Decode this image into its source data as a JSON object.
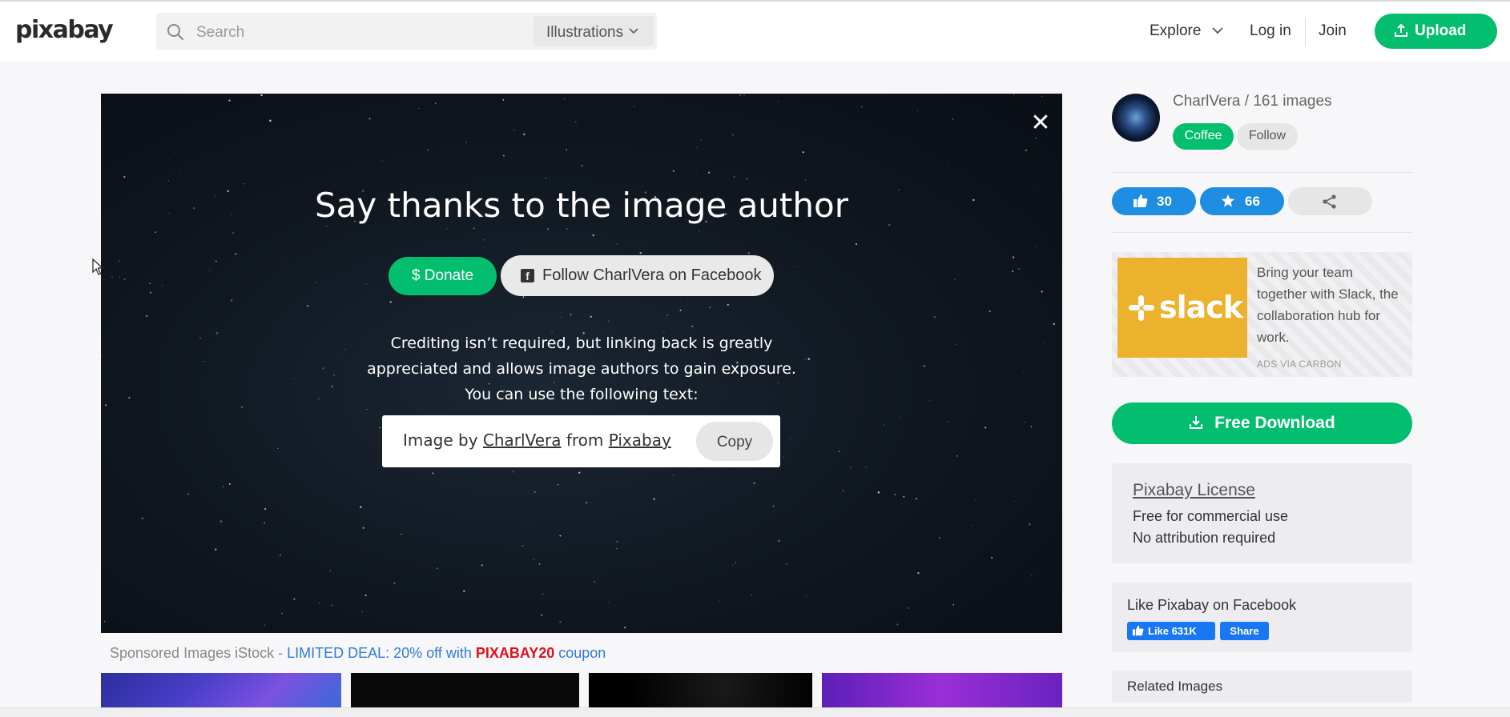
{
  "header": {
    "logo": "pixabay",
    "search_placeholder": "Search",
    "search_scope": "Illustrations",
    "nav_explore": "Explore",
    "nav_login": "Log in",
    "nav_join": "Join",
    "upload_label": "Upload"
  },
  "modal": {
    "title": "Say thanks to the image author",
    "donate_label": "$ Donate",
    "facebook_follow_label": "Follow CharlVera on Facebook",
    "credit_line1": "Crediting isn’t required, but linking back is greatly",
    "credit_line2": "appreciated and allows image authors to gain exposure.",
    "credit_line3": "You can use the following text:",
    "attribution": {
      "prefix": "Image by",
      "author": "CharlVera",
      "middle": "from",
      "site": "Pixabay"
    },
    "copy_label": "Copy",
    "close_glyph": "✕"
  },
  "sponsored": {
    "prefix": "Sponsored Images iStock - ",
    "deal": "LIMITED DEAL: 20% off with ",
    "code": "PIXABAY20",
    "suffix": " coupon"
  },
  "sidebar": {
    "author_line": "CharlVera / 161 images",
    "coffee_label": "Coffee",
    "follow_label": "Follow",
    "likes": "30",
    "favorites": "66",
    "ad": {
      "logo": "slack",
      "text": "Bring your team together with Slack, the collaboration hub for work.",
      "via": "ADS VIA CARBON"
    },
    "download_label": "Free Download",
    "license": {
      "title": "Pixabay License",
      "line1": "Free for commercial use",
      "line2": "No attribution required"
    },
    "facebook": {
      "title": "Like Pixabay on Facebook",
      "like_label": "Like 631K",
      "share_label": "Share"
    },
    "related_title": "Related Images"
  },
  "colors": {
    "brand_green": "#02be6e",
    "blue": "#1f8de2",
    "facebook_blue": "#1877f2",
    "coupon_red": "#e0101e",
    "deal_blue": "#2f7bd6"
  },
  "icons": [
    "search-icon",
    "chevron-down-icon",
    "upload-icon",
    "close-icon",
    "facebook-icon",
    "thumbs-up-icon",
    "star-icon",
    "share-icon",
    "download-icon",
    "cursor-icon"
  ]
}
